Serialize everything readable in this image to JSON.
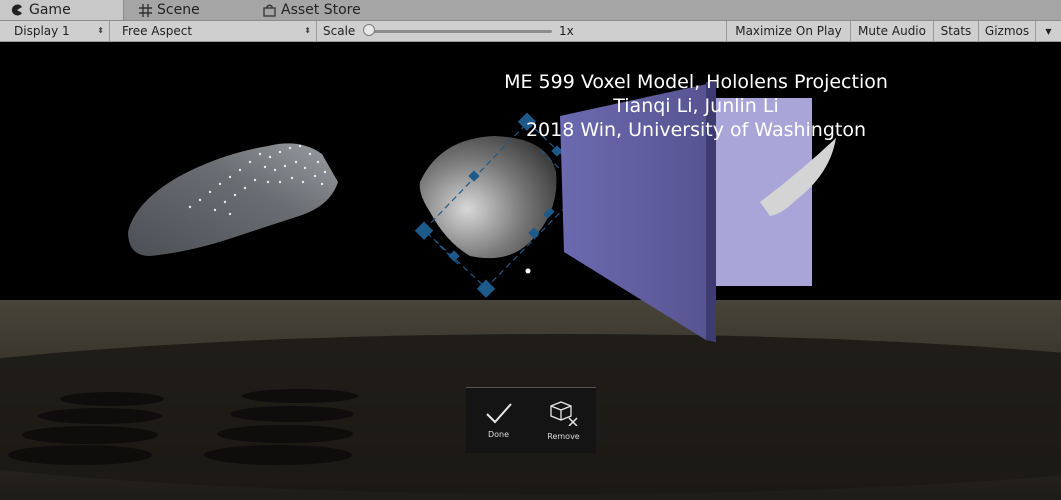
{
  "tabs": [
    {
      "label": "Game",
      "icon": "pacman-icon"
    },
    {
      "label": "Scene",
      "icon": "grid-icon"
    },
    {
      "label": "Asset Store",
      "icon": "bag-icon"
    }
  ],
  "toolbar": {
    "display": "Display 1",
    "aspect": "Free Aspect",
    "scale_label": "Scale",
    "scale_value": "1x",
    "maximize": "Maximize On Play",
    "mute": "Mute Audio",
    "stats": "Stats",
    "gizmos": "Gizmos"
  },
  "overlay": {
    "line1": "ME 599 Voxel Model, Hololens Projection",
    "line2": "Tianqi Li, Junlin Li",
    "line3": "2018 Win, University of Washington"
  },
  "holobar": {
    "done": "Done",
    "remove": "Remove"
  }
}
